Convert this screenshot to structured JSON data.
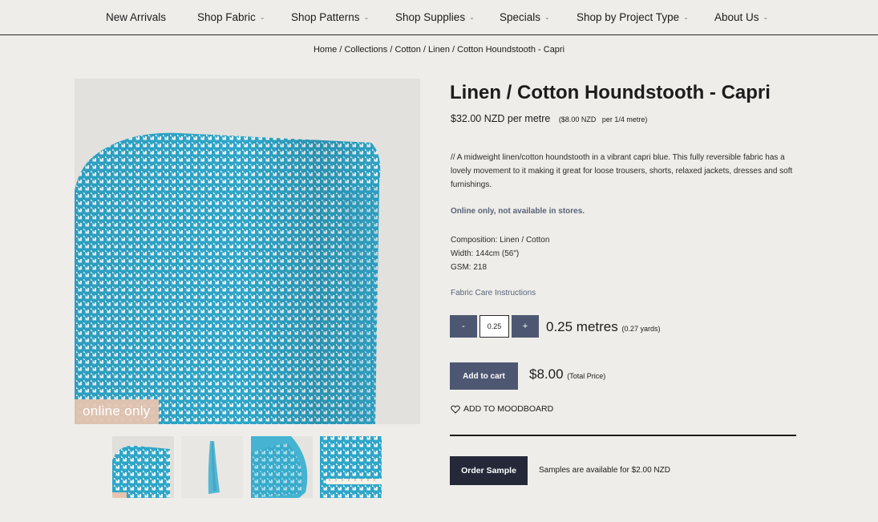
{
  "nav": {
    "items": [
      {
        "label": "New Arrivals",
        "has_dropdown": false
      },
      {
        "label": "Shop Fabric",
        "has_dropdown": true
      },
      {
        "label": "Shop Patterns",
        "has_dropdown": true
      },
      {
        "label": "Shop Supplies",
        "has_dropdown": true
      },
      {
        "label": "Specials",
        "has_dropdown": true
      },
      {
        "label": "Shop by Project Type",
        "has_dropdown": true
      },
      {
        "label": "About Us",
        "has_dropdown": true
      }
    ],
    "chevron": "⌄"
  },
  "breadcrumb": {
    "items": [
      "Home",
      "Collections",
      "Cotton",
      "Linen",
      "Cotton Houndstooth - Capri"
    ],
    "separator": " / "
  },
  "gallery": {
    "badge": "online only",
    "fabric_color": "#2ea6c9",
    "thumbnails": [
      "fabric-roll",
      "hanging-fabric",
      "fabric-bolt",
      "fabric-with-ruler"
    ]
  },
  "product": {
    "title": "Linen / Cotton Houndstooth - Capri",
    "price": "$32.00 NZD per metre",
    "price_quarter": "($8.00 NZD",
    "price_quarter_unit": "per 1/4 metre)",
    "description": "// A midweight linen/cotton houndstooth in a vibrant capri blue. This fully reversible fabric has a lovely movement to it making it great for loose trousers, shorts, relaxed jackets, dresses and soft furnishings.",
    "online_note": "Online only, not available in stores.",
    "specs": [
      "Composition: Linen / Cotton",
      "Width: 144cm (56\")",
      "GSM: 218"
    ],
    "care_link": "Fabric Care Instructions"
  },
  "quantity": {
    "minus_label": "-",
    "plus_label": "+",
    "value": "0.25",
    "metres_label": "0.25 metres",
    "yards_label": "(0.27 yards)"
  },
  "cart": {
    "add_label": "Add to cart",
    "total": "$8.00",
    "total_label": "(Total Price)",
    "moodboard_label": "ADD TO MOODBOARD"
  },
  "sample": {
    "button_label": "Order Sample",
    "note": "Samples are available for $2.00 NZD"
  },
  "colors": {
    "button": "#4e5772",
    "dark_button": "#252838",
    "background": "#eeede9",
    "accent_text": "#596378"
  }
}
